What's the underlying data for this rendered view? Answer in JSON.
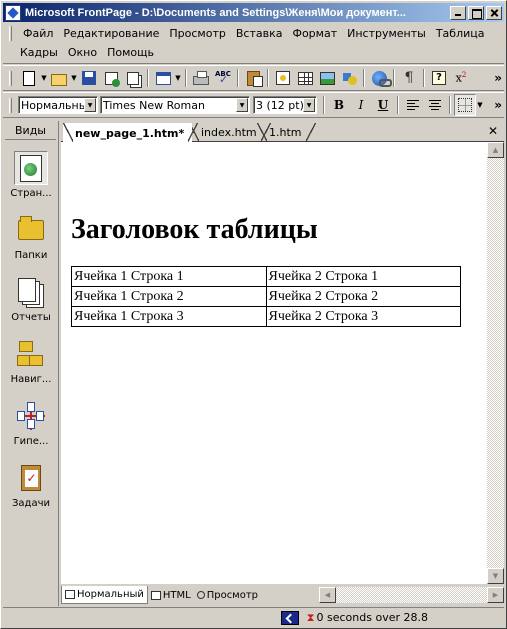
{
  "window": {
    "title": "Microsoft FrontPage - D:\\Documents and Settings\\Женя\\Мои документ..."
  },
  "menu": {
    "row1": [
      "Файл",
      "Редактирование",
      "Просмотр",
      "Вставка",
      "Формат",
      "Инструменты",
      "Таблица"
    ],
    "row2": [
      "Кадры",
      "Окно",
      "Помощь"
    ]
  },
  "format_toolbar": {
    "style": "Нормальный",
    "font": "Times New Roman",
    "size": "3  (12 pt)",
    "bold": "B",
    "italic": "I",
    "underline": "U"
  },
  "toolbar_icons": {
    "spell": "ABC",
    "pilcrow": "¶",
    "help": "?",
    "superscript_base": "x",
    "superscript_exp": "2",
    "more": "»"
  },
  "views": {
    "header": "Виды",
    "items": [
      {
        "label": "Стран...",
        "icon": "page-icon",
        "selected": true
      },
      {
        "label": "Папки",
        "icon": "folder-icon",
        "selected": false
      },
      {
        "label": "Отчеты",
        "icon": "reports-icon",
        "selected": false
      },
      {
        "label": "Навиг...",
        "icon": "navigation-icon",
        "selected": false
      },
      {
        "label": "Гипе...",
        "icon": "hyperlinks-icon",
        "selected": false
      },
      {
        "label": "Задачи",
        "icon": "tasks-icon",
        "selected": false
      }
    ]
  },
  "tabs": [
    {
      "label": "new_page_1.htm*",
      "active": true
    },
    {
      "label": "index.htm",
      "active": false
    },
    {
      "label": "1.htm",
      "active": false
    }
  ],
  "document": {
    "heading": "Заголовок таблицы",
    "table": [
      [
        "Ячейка 1 Строка 1",
        "Ячейка 2 Строка 1"
      ],
      [
        "Ячейка 1 Строка 2",
        "Ячейка 2 Строка 2"
      ],
      [
        "Ячейка 1 Строка 3",
        "Ячейка 2 Строка 3"
      ]
    ]
  },
  "view_tabs": {
    "normal": "Нормальный",
    "html": "HTML",
    "preview": "Просмотр"
  },
  "status": {
    "text": "0 seconds over 28.8"
  }
}
